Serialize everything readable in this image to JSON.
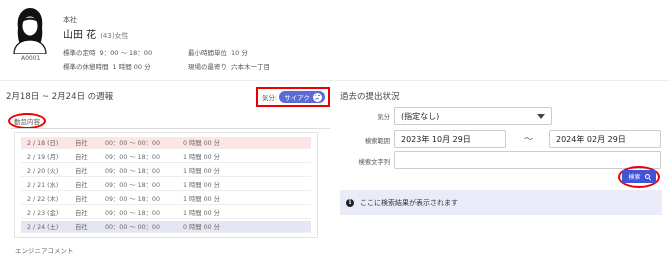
{
  "profile": {
    "employee_id": "A0001",
    "company": "本社",
    "name": "山田 花",
    "age_gender": "(43)女性",
    "standard_hours_label": "標準の定時",
    "standard_hours_value": "9：00 〜 18：00",
    "min_unit_label": "最小時間単位",
    "min_unit_value": "10 分",
    "standard_break_label": "標準の休憩時間",
    "standard_break_value": "1 時間 00 分",
    "nearest_station_label": "現場の最寄り",
    "nearest_station_value": "六本木一丁目"
  },
  "weekly": {
    "title": "2月18日 ~ 2月24日 の週報",
    "mood_label": "気分:",
    "mood_value": "サイアク",
    "section_tab": "勤怠内容",
    "rows": [
      {
        "date": "2 / 18 (日)",
        "place": "自社",
        "time": "00：00 〜 00：00",
        "break": "0 時間 00 分",
        "kind": "sun"
      },
      {
        "date": "2 / 19 (月)",
        "place": "自社",
        "time": "09：00 〜 18：00",
        "break": "1 時間 00 分",
        "kind": "weekday"
      },
      {
        "date": "2 / 20 (火)",
        "place": "自社",
        "time": "09：00 〜 18：00",
        "break": "1 時間 00 分",
        "kind": "weekday"
      },
      {
        "date": "2 / 21 (水)",
        "place": "自社",
        "time": "09：00 〜 18：00",
        "break": "1 時間 00 分",
        "kind": "weekday"
      },
      {
        "date": "2 / 22 (木)",
        "place": "自社",
        "time": "09：00 〜 18：00",
        "break": "1 時間 00 分",
        "kind": "weekday"
      },
      {
        "date": "2 / 23 (金)",
        "place": "自社",
        "time": "09：00 〜 18：00",
        "break": "1 時間 00 分",
        "kind": "weekday"
      },
      {
        "date": "2 / 24 (土)",
        "place": "自社",
        "time": "00：00 〜 00：00",
        "break": "0 時間 00 分",
        "kind": "sat"
      }
    ],
    "engineer_comment_label": "エンジニアコメント"
  },
  "past": {
    "title": "過去の提出状況",
    "mood_label": "気分",
    "mood_selected": "(指定なし)",
    "range_label": "検索範囲",
    "range_from": "2023年 10月 29日",
    "range_sep": "〜",
    "range_to": "2024年 02月 29日",
    "keyword_label": "検索文字列",
    "keyword_value": "",
    "search_button": "検索",
    "result_message": "ここに検索結果が表示されます"
  },
  "colors": {
    "accent": "#4254d6",
    "mood_pill": "#5b6bd6",
    "sunday_row": "#fde5e5",
    "saturday_row": "#e4e6f3",
    "annotation_red": "#e00000"
  }
}
